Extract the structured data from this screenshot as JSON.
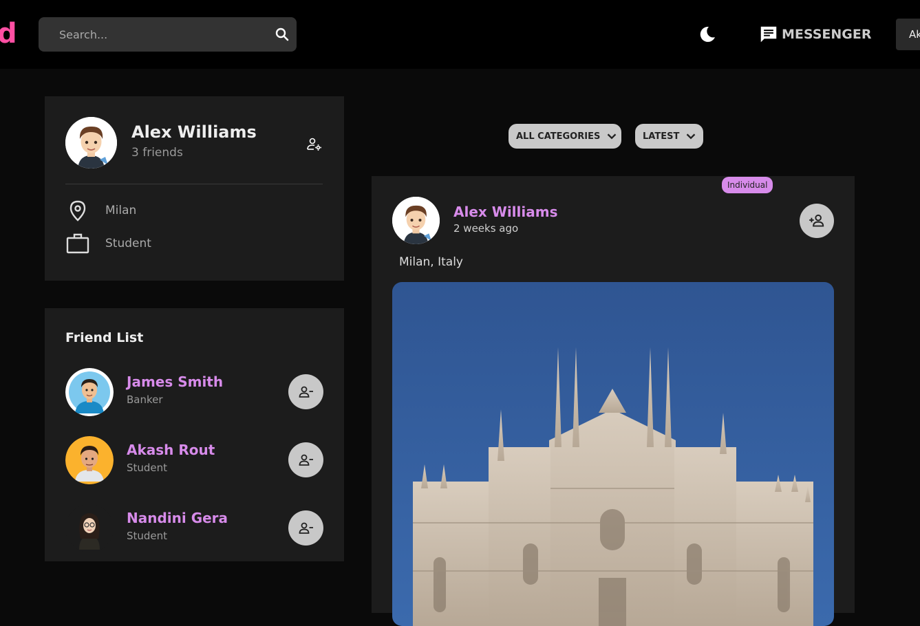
{
  "navbar": {
    "logo_text": "d",
    "search_placeholder": "Search...",
    "messenger_label": "MESSENGER",
    "user_label": "Ak"
  },
  "profile": {
    "name": "Alex Williams",
    "friends_text": "3 friends",
    "location": "Milan",
    "occupation": "Student"
  },
  "friend_list": {
    "title": "Friend List",
    "friends": [
      {
        "name": "James Smith",
        "occupation": "Banker"
      },
      {
        "name": "Akash Rout",
        "occupation": "Student"
      },
      {
        "name": "Nandini Gera",
        "occupation": "Student"
      }
    ]
  },
  "filters": {
    "category": "ALL CATEGORIES",
    "sort": "LATEST"
  },
  "post": {
    "badge": "Individual",
    "author": "Alex Williams",
    "time": "2 weeks ago",
    "location": "Milan, Italy"
  },
  "colors": {
    "accent": "#d78bea",
    "brand": "#ff4fa3",
    "card_bg": "#1c1c1c",
    "page_bg": "#0a0a0a"
  },
  "icons": [
    "search-icon",
    "moon-icon",
    "chat-icon",
    "manage-accounts-icon",
    "location-pin-icon",
    "briefcase-icon",
    "person-remove-icon",
    "person-add-icon",
    "chevron-down-icon"
  ]
}
